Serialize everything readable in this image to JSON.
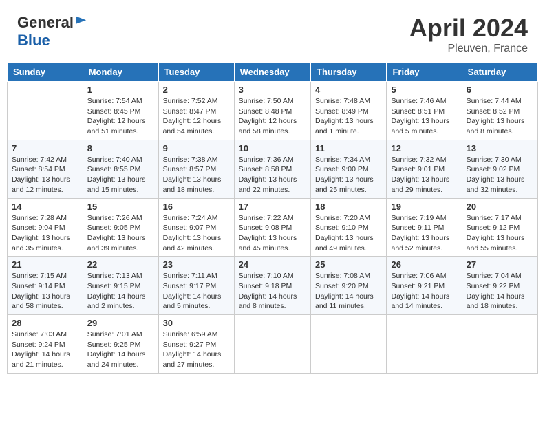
{
  "header": {
    "logo_general": "General",
    "logo_blue": "Blue",
    "month_year": "April 2024",
    "location": "Pleuven, France"
  },
  "days_of_week": [
    "Sunday",
    "Monday",
    "Tuesday",
    "Wednesday",
    "Thursday",
    "Friday",
    "Saturday"
  ],
  "weeks": [
    {
      "days": [
        {
          "number": "",
          "info": ""
        },
        {
          "number": "1",
          "info": "Sunrise: 7:54 AM\nSunset: 8:45 PM\nDaylight: 12 hours\nand 51 minutes."
        },
        {
          "number": "2",
          "info": "Sunrise: 7:52 AM\nSunset: 8:47 PM\nDaylight: 12 hours\nand 54 minutes."
        },
        {
          "number": "3",
          "info": "Sunrise: 7:50 AM\nSunset: 8:48 PM\nDaylight: 12 hours\nand 58 minutes."
        },
        {
          "number": "4",
          "info": "Sunrise: 7:48 AM\nSunset: 8:49 PM\nDaylight: 13 hours\nand 1 minute."
        },
        {
          "number": "5",
          "info": "Sunrise: 7:46 AM\nSunset: 8:51 PM\nDaylight: 13 hours\nand 5 minutes."
        },
        {
          "number": "6",
          "info": "Sunrise: 7:44 AM\nSunset: 8:52 PM\nDaylight: 13 hours\nand 8 minutes."
        }
      ]
    },
    {
      "days": [
        {
          "number": "7",
          "info": "Sunrise: 7:42 AM\nSunset: 8:54 PM\nDaylight: 13 hours\nand 12 minutes."
        },
        {
          "number": "8",
          "info": "Sunrise: 7:40 AM\nSunset: 8:55 PM\nDaylight: 13 hours\nand 15 minutes."
        },
        {
          "number": "9",
          "info": "Sunrise: 7:38 AM\nSunset: 8:57 PM\nDaylight: 13 hours\nand 18 minutes."
        },
        {
          "number": "10",
          "info": "Sunrise: 7:36 AM\nSunset: 8:58 PM\nDaylight: 13 hours\nand 22 minutes."
        },
        {
          "number": "11",
          "info": "Sunrise: 7:34 AM\nSunset: 9:00 PM\nDaylight: 13 hours\nand 25 minutes."
        },
        {
          "number": "12",
          "info": "Sunrise: 7:32 AM\nSunset: 9:01 PM\nDaylight: 13 hours\nand 29 minutes."
        },
        {
          "number": "13",
          "info": "Sunrise: 7:30 AM\nSunset: 9:02 PM\nDaylight: 13 hours\nand 32 minutes."
        }
      ]
    },
    {
      "days": [
        {
          "number": "14",
          "info": "Sunrise: 7:28 AM\nSunset: 9:04 PM\nDaylight: 13 hours\nand 35 minutes."
        },
        {
          "number": "15",
          "info": "Sunrise: 7:26 AM\nSunset: 9:05 PM\nDaylight: 13 hours\nand 39 minutes."
        },
        {
          "number": "16",
          "info": "Sunrise: 7:24 AM\nSunset: 9:07 PM\nDaylight: 13 hours\nand 42 minutes."
        },
        {
          "number": "17",
          "info": "Sunrise: 7:22 AM\nSunset: 9:08 PM\nDaylight: 13 hours\nand 45 minutes."
        },
        {
          "number": "18",
          "info": "Sunrise: 7:20 AM\nSunset: 9:10 PM\nDaylight: 13 hours\nand 49 minutes."
        },
        {
          "number": "19",
          "info": "Sunrise: 7:19 AM\nSunset: 9:11 PM\nDaylight: 13 hours\nand 52 minutes."
        },
        {
          "number": "20",
          "info": "Sunrise: 7:17 AM\nSunset: 9:12 PM\nDaylight: 13 hours\nand 55 minutes."
        }
      ]
    },
    {
      "days": [
        {
          "number": "21",
          "info": "Sunrise: 7:15 AM\nSunset: 9:14 PM\nDaylight: 13 hours\nand 58 minutes."
        },
        {
          "number": "22",
          "info": "Sunrise: 7:13 AM\nSunset: 9:15 PM\nDaylight: 14 hours\nand 2 minutes."
        },
        {
          "number": "23",
          "info": "Sunrise: 7:11 AM\nSunset: 9:17 PM\nDaylight: 14 hours\nand 5 minutes."
        },
        {
          "number": "24",
          "info": "Sunrise: 7:10 AM\nSunset: 9:18 PM\nDaylight: 14 hours\nand 8 minutes."
        },
        {
          "number": "25",
          "info": "Sunrise: 7:08 AM\nSunset: 9:20 PM\nDaylight: 14 hours\nand 11 minutes."
        },
        {
          "number": "26",
          "info": "Sunrise: 7:06 AM\nSunset: 9:21 PM\nDaylight: 14 hours\nand 14 minutes."
        },
        {
          "number": "27",
          "info": "Sunrise: 7:04 AM\nSunset: 9:22 PM\nDaylight: 14 hours\nand 18 minutes."
        }
      ]
    },
    {
      "days": [
        {
          "number": "28",
          "info": "Sunrise: 7:03 AM\nSunset: 9:24 PM\nDaylight: 14 hours\nand 21 minutes."
        },
        {
          "number": "29",
          "info": "Sunrise: 7:01 AM\nSunset: 9:25 PM\nDaylight: 14 hours\nand 24 minutes."
        },
        {
          "number": "30",
          "info": "Sunrise: 6:59 AM\nSunset: 9:27 PM\nDaylight: 14 hours\nand 27 minutes."
        },
        {
          "number": "",
          "info": ""
        },
        {
          "number": "",
          "info": ""
        },
        {
          "number": "",
          "info": ""
        },
        {
          "number": "",
          "info": ""
        }
      ]
    }
  ]
}
